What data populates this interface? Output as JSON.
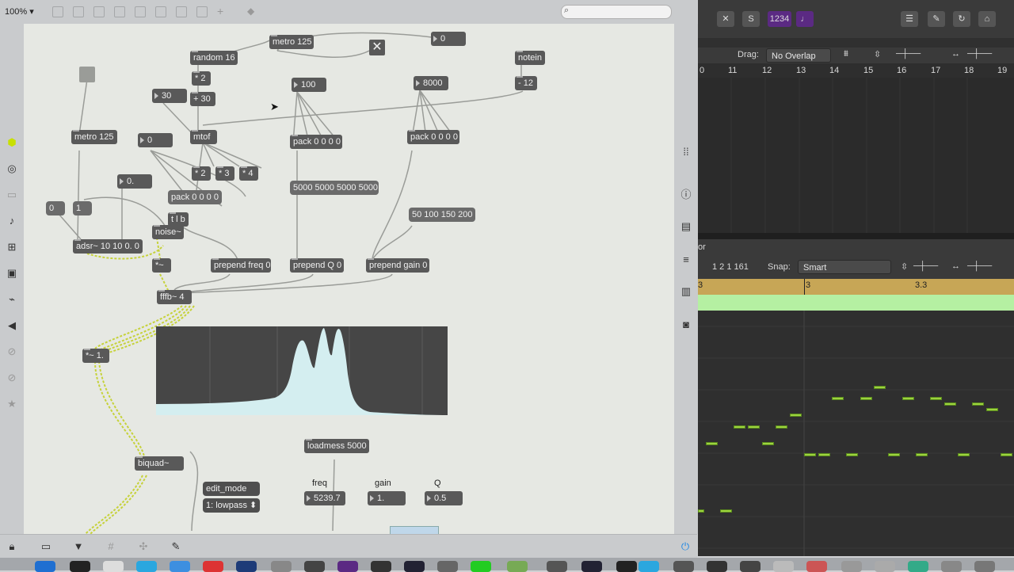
{
  "max": {
    "zoom": "100%",
    "search_placeholder": "",
    "objects": {
      "metro_top": "metro 125",
      "num_top": "0",
      "notein": "notein",
      "random": "random 16",
      "mul2": "* 2",
      "plus30": "+ 30",
      "num30": "30",
      "num100": "100",
      "num8000": "8000",
      "minus12": "- 12",
      "metro_left": "metro 125",
      "num0a": "0",
      "mtof": "mtof",
      "pack1": "pack 0 0 0 0",
      "pack2": "pack 0 0 0 0",
      "num0dot": "0.",
      "m2": "* 2",
      "m3": "* 3",
      "m4": "* 4",
      "msg0": "0",
      "msg1": "1",
      "pack3": "pack 0 0 0 0",
      "msg5000": "5000 5000 5000 5000",
      "tlb": "t l b",
      "msg50": "50 100 150 200",
      "noise": "noise~",
      "adsr": "adsr~ 10 10 0. 0",
      "mulsig": "*~",
      "prepend_freq": "prepend freq 0",
      "prepend_q": "prepend Q 0",
      "prepend_gain": "prepend gain 0",
      "fffb": "fffb~ 4",
      "mul1": "*~ 1.",
      "biquad": "biquad~",
      "loadmess": "loadmess 5000",
      "edit_mode": "edit_mode",
      "lowpass": "1: lowpass"
    },
    "labels": {
      "freq": "freq",
      "gain": "gain",
      "q": "Q"
    },
    "values": {
      "freq": "5239.7",
      "gain": "1.",
      "q": "0.5"
    }
  },
  "logic": {
    "toolbar_counter": "1234",
    "drag_label": "Drag:",
    "drag_value": "No Overlap",
    "ruler_top": [
      "0",
      "11",
      "12",
      "13",
      "14",
      "15",
      "16",
      "17",
      "18",
      "19"
    ],
    "editor_title": "or",
    "position": "1 2 1 161",
    "snap_label": "Snap:",
    "snap_value": "Smart",
    "ruler_bottom": [
      "3",
      "3",
      "3.3"
    ]
  },
  "colors": {
    "patch_bg": "#e6e8e3",
    "object_bg": "#595959",
    "spectrum_fill": "#d4eef0",
    "note": "#9cd33f",
    "region": "#b5f0a2",
    "ruler": "#c7a656"
  }
}
